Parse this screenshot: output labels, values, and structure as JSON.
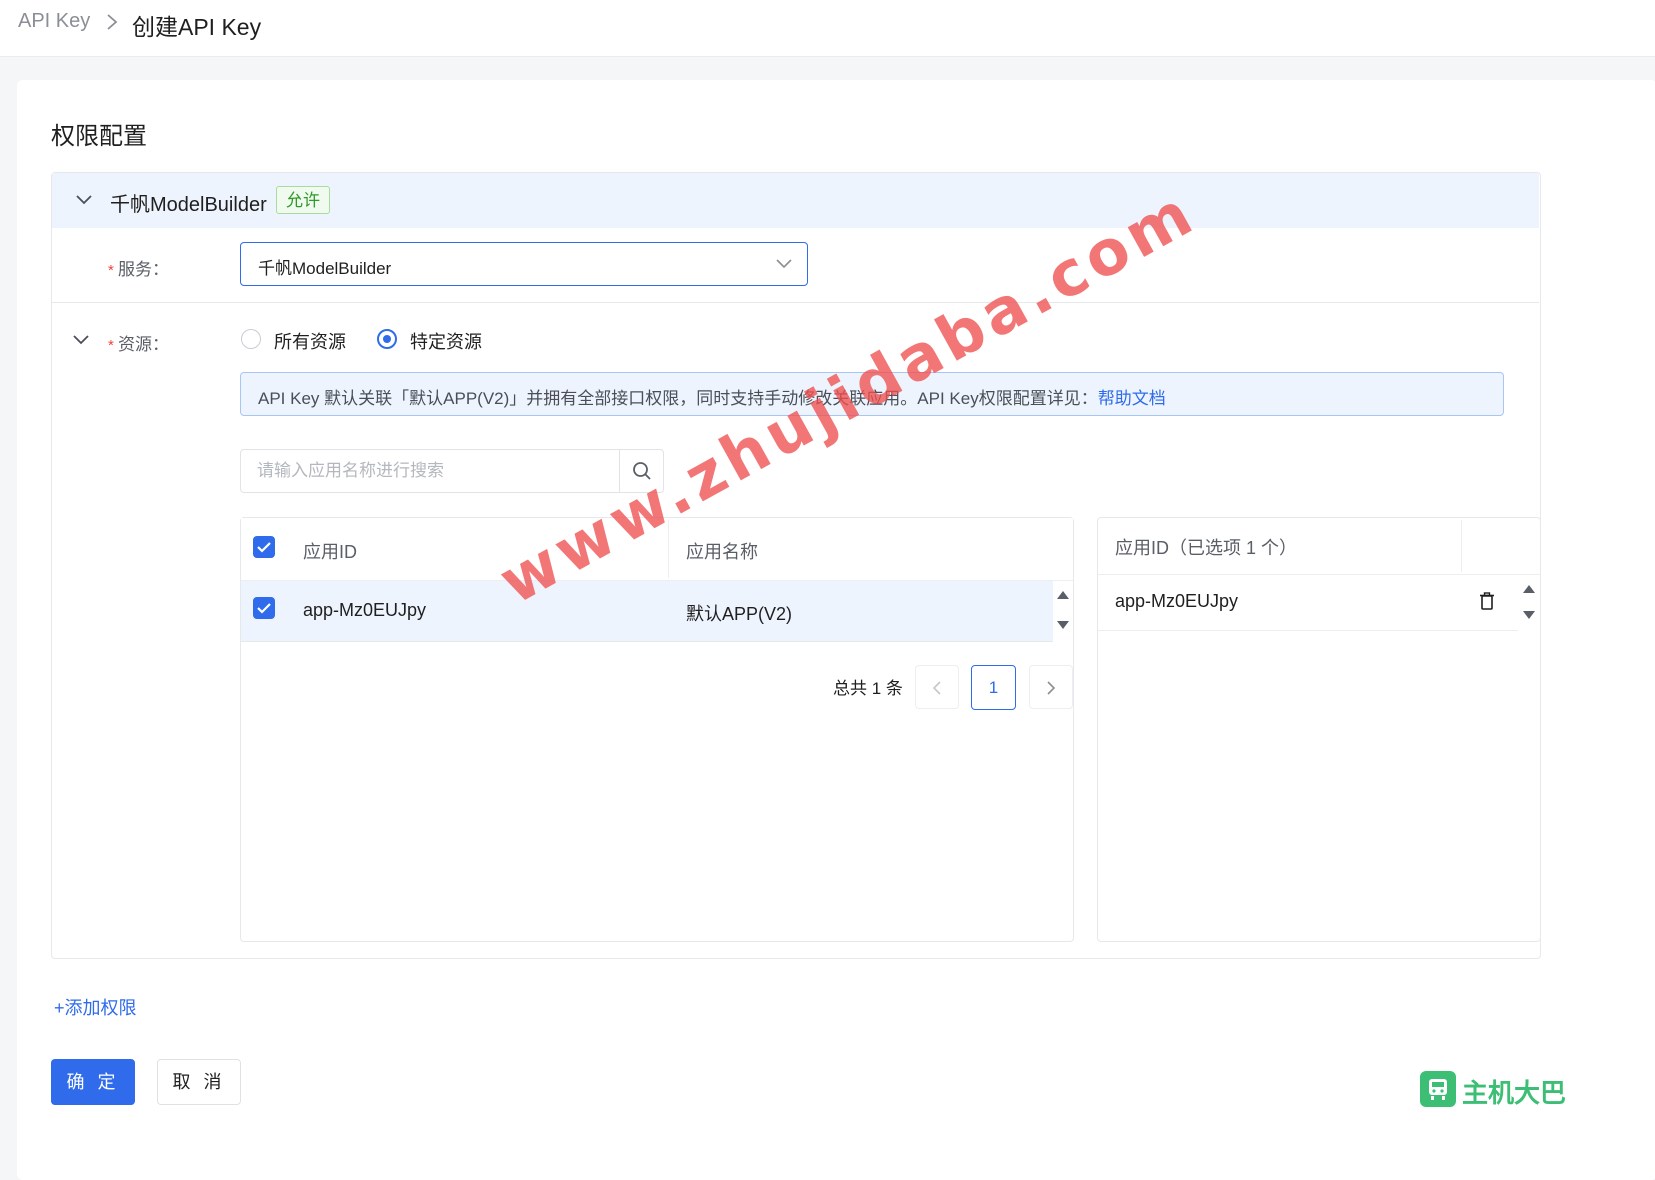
{
  "breadcrumb": {
    "parent": "API Key",
    "current": "创建API Key"
  },
  "section_title": "权限配置",
  "permission": {
    "product": "千帆ModelBuilder",
    "tag": "允许",
    "service_label": "服务：",
    "service_value": "千帆ModelBuilder",
    "resource_label": "资源：",
    "resource_options": [
      "所有资源",
      "特定资源"
    ],
    "resource_selected": "特定资源",
    "info_text": "API Key 默认关联「默认APP(V2)」并拥有全部接口权限，同时支持手动修改关联应用。API Key权限配置详见：",
    "info_link": "帮助文档",
    "search_placeholder": "请输入应用名称进行搜索",
    "table": {
      "headers": [
        "应用ID",
        "应用名称"
      ],
      "rows": [
        {
          "app_id": "app-Mz0EUJpy",
          "app_name": "默认APP(V2)",
          "checked": true
        }
      ]
    },
    "pagination": {
      "total": "总共 1 条",
      "current_page": "1"
    },
    "selected_panel": {
      "header": "应用ID（已选项 1 个）",
      "items": [
        "app-Mz0EUJpy"
      ]
    }
  },
  "add_permission": "添加权限",
  "buttons": {
    "confirm": "确 定",
    "cancel": "取 消"
  },
  "watermark": "www.zhujidaba.com",
  "logo_text": "主机大巴",
  "colors": {
    "primary": "#2f6bea",
    "success": "#2e9a28",
    "required": "#f0443c",
    "watermark": "#f05050",
    "logo": "#3cbf74"
  }
}
